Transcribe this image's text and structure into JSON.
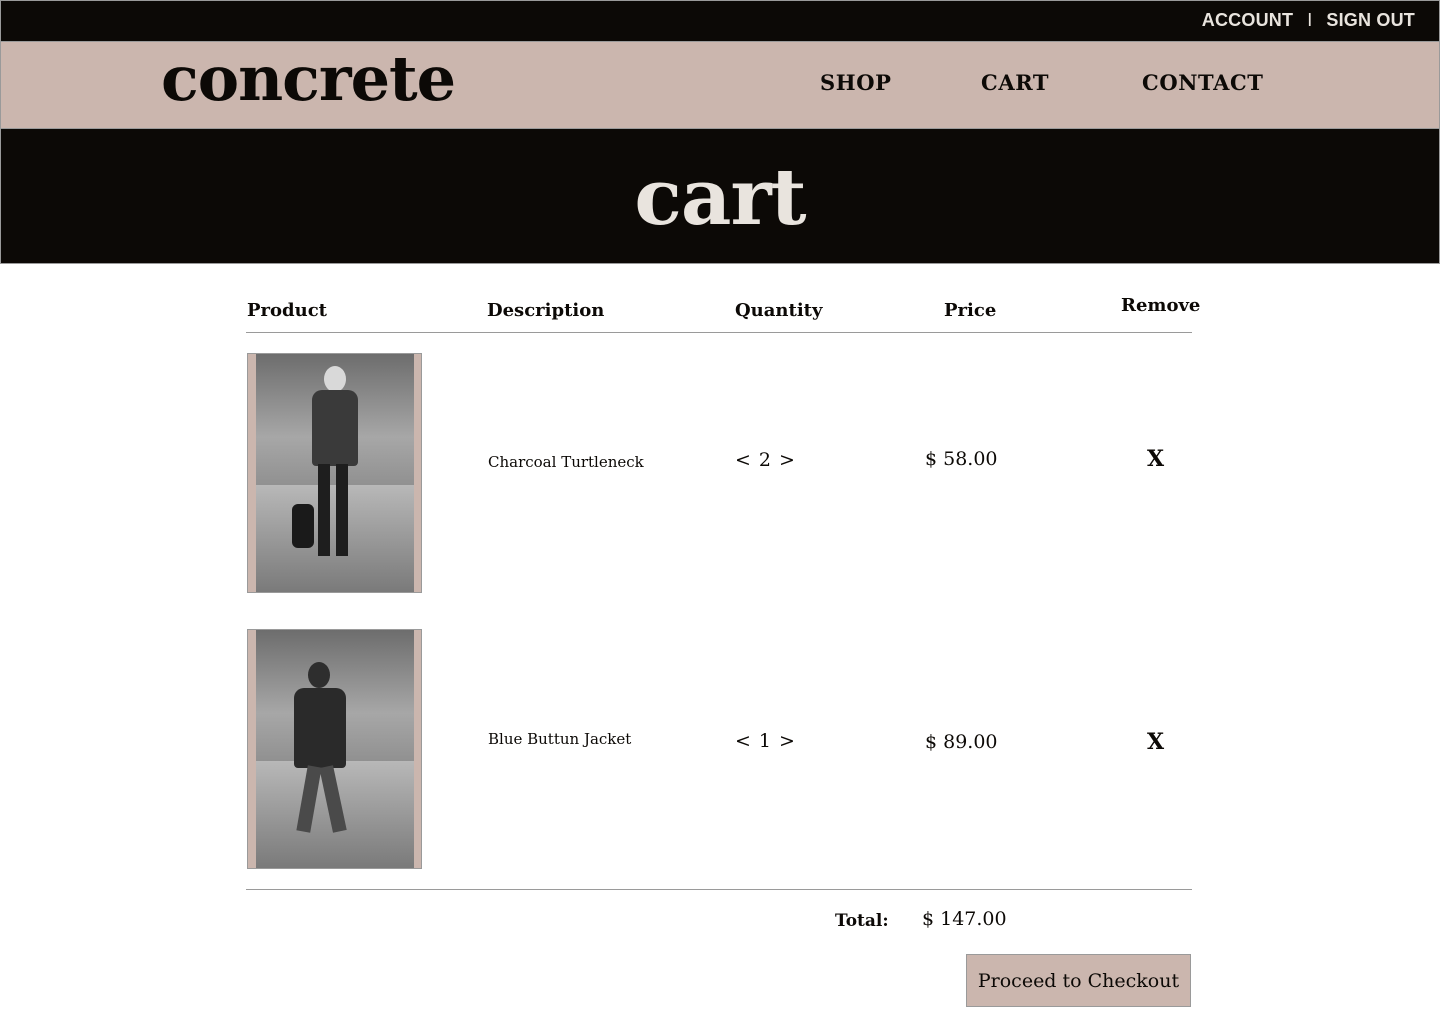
{
  "topbar": {
    "account_label": "ACCOUNT",
    "separator": "I",
    "signout_label": "SIGN OUT"
  },
  "header": {
    "logo": "concrete",
    "nav": {
      "shop": "SHOP",
      "cart": "CART",
      "contact": "CONTACT"
    }
  },
  "hero": {
    "title": "cart"
  },
  "table": {
    "headers": {
      "product": "Product",
      "description": "Description",
      "quantity": "Quantity",
      "price": "Price",
      "remove": "Remove"
    },
    "rows": [
      {
        "description": "Charcoal Turtleneck",
        "qty_dec": "<",
        "quantity": "2",
        "qty_inc": ">",
        "price": "$ 58.00",
        "remove": "X"
      },
      {
        "description": "Blue Buttun Jacket",
        "qty_dec": "<",
        "quantity": "1",
        "qty_inc": ">",
        "price": "$ 89.00",
        "remove": "X"
      }
    ]
  },
  "summary": {
    "total_label": "Total:",
    "total_value": "$ 147.00",
    "checkout_label": "Proceed to Checkout"
  },
  "colors": {
    "dark": "#0c0906",
    "blush": "#cbb6ae",
    "cream": "#e9e4de",
    "rule": "#9a9a9a"
  }
}
